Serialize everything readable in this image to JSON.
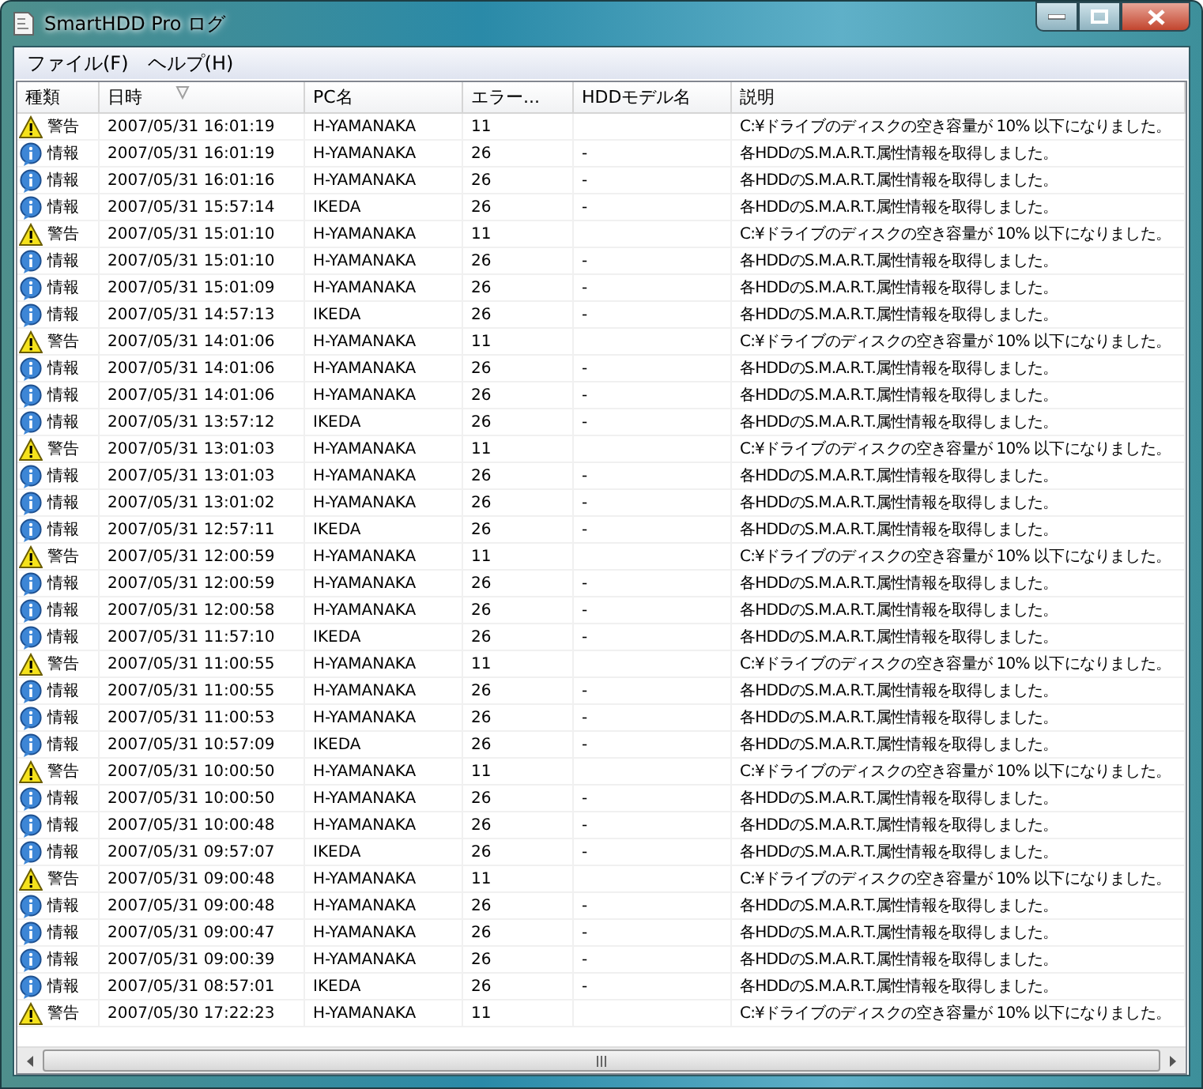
{
  "window": {
    "title": "SmartHDD Pro ログ"
  },
  "menu": [
    {
      "label": "ファイル(F)"
    },
    {
      "label": "ヘルプ(H)"
    }
  ],
  "table": {
    "columns": [
      {
        "label": "種類",
        "sorted": false
      },
      {
        "label": "日時",
        "sorted": true
      },
      {
        "label": "PC名",
        "sorted": false
      },
      {
        "label": "エラー...",
        "sorted": false
      },
      {
        "label": "HDDモデル名",
        "sorted": false
      },
      {
        "label": "説明",
        "sorted": false
      }
    ],
    "rows": [
      {
        "kind": "warning",
        "type": "警告",
        "datetime": "2007/05/31 16:01:19",
        "pc": "H-YAMANAKA",
        "error": "11",
        "description": "C:¥ドライブのディスクの空き容量が 10% 以下になりました。"
      },
      {
        "kind": "info",
        "type": "情報",
        "datetime": "2007/05/31 16:01:19",
        "pc": "H-YAMANAKA",
        "error": "26",
        "model": "-",
        "description": "各HDDのS.M.A.R.T.属性情報を取得しました。"
      },
      {
        "kind": "info",
        "type": "情報",
        "datetime": "2007/05/31 16:01:16",
        "pc": "H-YAMANAKA",
        "error": "26",
        "model": "-",
        "description": "各HDDのS.M.A.R.T.属性情報を取得しました。"
      },
      {
        "kind": "info",
        "type": "情報",
        "datetime": "2007/05/31 15:57:14",
        "pc": "IKEDA",
        "error": "26",
        "model": "-",
        "description": "各HDDのS.M.A.R.T.属性情報を取得しました。"
      },
      {
        "kind": "warning",
        "type": "警告",
        "datetime": "2007/05/31 15:01:10",
        "pc": "H-YAMANAKA",
        "error": "11",
        "description": "C:¥ドライブのディスクの空き容量が 10% 以下になりました。"
      },
      {
        "kind": "info",
        "type": "情報",
        "datetime": "2007/05/31 15:01:10",
        "pc": "H-YAMANAKA",
        "error": "26",
        "model": "-",
        "description": "各HDDのS.M.A.R.T.属性情報を取得しました。"
      },
      {
        "kind": "info",
        "type": "情報",
        "datetime": "2007/05/31 15:01:09",
        "pc": "H-YAMANAKA",
        "error": "26",
        "model": "-",
        "description": "各HDDのS.M.A.R.T.属性情報を取得しました。"
      },
      {
        "kind": "info",
        "type": "情報",
        "datetime": "2007/05/31 14:57:13",
        "pc": "IKEDA",
        "error": "26",
        "model": "-",
        "description": "各HDDのS.M.A.R.T.属性情報を取得しました。"
      },
      {
        "kind": "warning",
        "type": "警告",
        "datetime": "2007/05/31 14:01:06",
        "pc": "H-YAMANAKA",
        "error": "11",
        "description": "C:¥ドライブのディスクの空き容量が 10% 以下になりました。"
      },
      {
        "kind": "info",
        "type": "情報",
        "datetime": "2007/05/31 14:01:06",
        "pc": "H-YAMANAKA",
        "error": "26",
        "model": "-",
        "description": "各HDDのS.M.A.R.T.属性情報を取得しました。"
      },
      {
        "kind": "info",
        "type": "情報",
        "datetime": "2007/05/31 14:01:06",
        "pc": "H-YAMANAKA",
        "error": "26",
        "model": "-",
        "description": "各HDDのS.M.A.R.T.属性情報を取得しました。"
      },
      {
        "kind": "info",
        "type": "情報",
        "datetime": "2007/05/31 13:57:12",
        "pc": "IKEDA",
        "error": "26",
        "model": "-",
        "description": "各HDDのS.M.A.R.T.属性情報を取得しました。"
      },
      {
        "kind": "warning",
        "type": "警告",
        "datetime": "2007/05/31 13:01:03",
        "pc": "H-YAMANAKA",
        "error": "11",
        "description": "C:¥ドライブのディスクの空き容量が 10% 以下になりました。"
      },
      {
        "kind": "info",
        "type": "情報",
        "datetime": "2007/05/31 13:01:03",
        "pc": "H-YAMANAKA",
        "error": "26",
        "model": "-",
        "description": "各HDDのS.M.A.R.T.属性情報を取得しました。"
      },
      {
        "kind": "info",
        "type": "情報",
        "datetime": "2007/05/31 13:01:02",
        "pc": "H-YAMANAKA",
        "error": "26",
        "model": "-",
        "description": "各HDDのS.M.A.R.T.属性情報を取得しました。"
      },
      {
        "kind": "info",
        "type": "情報",
        "datetime": "2007/05/31 12:57:11",
        "pc": "IKEDA",
        "error": "26",
        "model": "-",
        "description": "各HDDのS.M.A.R.T.属性情報を取得しました。"
      },
      {
        "kind": "warning",
        "type": "警告",
        "datetime": "2007/05/31 12:00:59",
        "pc": "H-YAMANAKA",
        "error": "11",
        "description": "C:¥ドライブのディスクの空き容量が 10% 以下になりました。"
      },
      {
        "kind": "info",
        "type": "情報",
        "datetime": "2007/05/31 12:00:59",
        "pc": "H-YAMANAKA",
        "error": "26",
        "model": "-",
        "description": "各HDDのS.M.A.R.T.属性情報を取得しました。"
      },
      {
        "kind": "info",
        "type": "情報",
        "datetime": "2007/05/31 12:00:58",
        "pc": "H-YAMANAKA",
        "error": "26",
        "model": "-",
        "description": "各HDDのS.M.A.R.T.属性情報を取得しました。"
      },
      {
        "kind": "info",
        "type": "情報",
        "datetime": "2007/05/31 11:57:10",
        "pc": "IKEDA",
        "error": "26",
        "model": "-",
        "description": "各HDDのS.M.A.R.T.属性情報を取得しました。"
      },
      {
        "kind": "warning",
        "type": "警告",
        "datetime": "2007/05/31 11:00:55",
        "pc": "H-YAMANAKA",
        "error": "11",
        "description": "C:¥ドライブのディスクの空き容量が 10% 以下になりました。"
      },
      {
        "kind": "info",
        "type": "情報",
        "datetime": "2007/05/31 11:00:55",
        "pc": "H-YAMANAKA",
        "error": "26",
        "model": "-",
        "description": "各HDDのS.M.A.R.T.属性情報を取得しました。"
      },
      {
        "kind": "info",
        "type": "情報",
        "datetime": "2007/05/31 11:00:53",
        "pc": "H-YAMANAKA",
        "error": "26",
        "model": "-",
        "description": "各HDDのS.M.A.R.T.属性情報を取得しました。"
      },
      {
        "kind": "info",
        "type": "情報",
        "datetime": "2007/05/31 10:57:09",
        "pc": "IKEDA",
        "error": "26",
        "model": "-",
        "description": "各HDDのS.M.A.R.T.属性情報を取得しました。"
      },
      {
        "kind": "warning",
        "type": "警告",
        "datetime": "2007/05/31 10:00:50",
        "pc": "H-YAMANAKA",
        "error": "11",
        "description": "C:¥ドライブのディスクの空き容量が 10% 以下になりました。"
      },
      {
        "kind": "info",
        "type": "情報",
        "datetime": "2007/05/31 10:00:50",
        "pc": "H-YAMANAKA",
        "error": "26",
        "model": "-",
        "description": "各HDDのS.M.A.R.T.属性情報を取得しました。"
      },
      {
        "kind": "info",
        "type": "情報",
        "datetime": "2007/05/31 10:00:48",
        "pc": "H-YAMANAKA",
        "error": "26",
        "model": "-",
        "description": "各HDDのS.M.A.R.T.属性情報を取得しました。"
      },
      {
        "kind": "info",
        "type": "情報",
        "datetime": "2007/05/31 09:57:07",
        "pc": "IKEDA",
        "error": "26",
        "model": "-",
        "description": "各HDDのS.M.A.R.T.属性情報を取得しました。"
      },
      {
        "kind": "warning",
        "type": "警告",
        "datetime": "2007/05/31 09:00:48",
        "pc": "H-YAMANAKA",
        "error": "11",
        "description": "C:¥ドライブのディスクの空き容量が 10% 以下になりました。"
      },
      {
        "kind": "info",
        "type": "情報",
        "datetime": "2007/05/31 09:00:48",
        "pc": "H-YAMANAKA",
        "error": "26",
        "model": "-",
        "description": "各HDDのS.M.A.R.T.属性情報を取得しました。"
      },
      {
        "kind": "info",
        "type": "情報",
        "datetime": "2007/05/31 09:00:47",
        "pc": "H-YAMANAKA",
        "error": "26",
        "model": "-",
        "description": "各HDDのS.M.A.R.T.属性情報を取得しました。"
      },
      {
        "kind": "info",
        "type": "情報",
        "datetime": "2007/05/31 09:00:39",
        "pc": "H-YAMANAKA",
        "error": "26",
        "model": "-",
        "description": "各HDDのS.M.A.R.T.属性情報を取得しました。"
      },
      {
        "kind": "info",
        "type": "情報",
        "datetime": "2007/05/31 08:57:01",
        "pc": "IKEDA",
        "error": "26",
        "model": "-",
        "description": "各HDDのS.M.A.R.T.属性情報を取得しました。"
      },
      {
        "kind": "warning",
        "type": "警告",
        "datetime": "2007/05/30 17:22:23",
        "pc": "H-YAMANAKA",
        "error": "11",
        "description": "C:¥ドライブのディスクの空き容量が 10% 以下になりました。"
      }
    ]
  }
}
